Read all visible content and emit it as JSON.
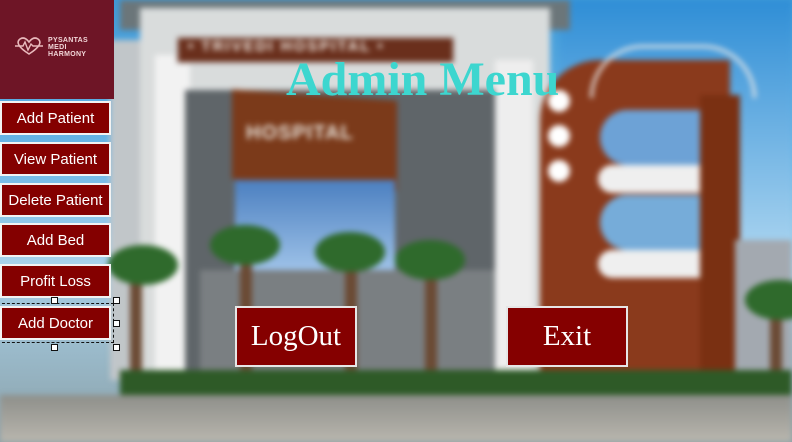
{
  "background": {
    "sign_text": "• TRIVEDI HOSPITAL •",
    "facade_text": "HOSPITAL"
  },
  "logo": {
    "line1": "PYSANTAS",
    "line2": "MEDI",
    "line3": "HARMONY",
    "mark_icon": "heart-pulse-icon"
  },
  "title": "Admin Menu",
  "sidebar": {
    "items": [
      {
        "label": "Add Patient"
      },
      {
        "label": "View Patient"
      },
      {
        "label": "Delete Patient"
      },
      {
        "label": "Add Bed"
      },
      {
        "label": "Profit Loss"
      },
      {
        "label": "Add Doctor"
      }
    ]
  },
  "actions": {
    "logout_label": "LogOut",
    "exit_label": "Exit"
  },
  "colors": {
    "button_bg": "#840000",
    "title": "#3dd6cf",
    "logo_bg": "#6e1526"
  }
}
